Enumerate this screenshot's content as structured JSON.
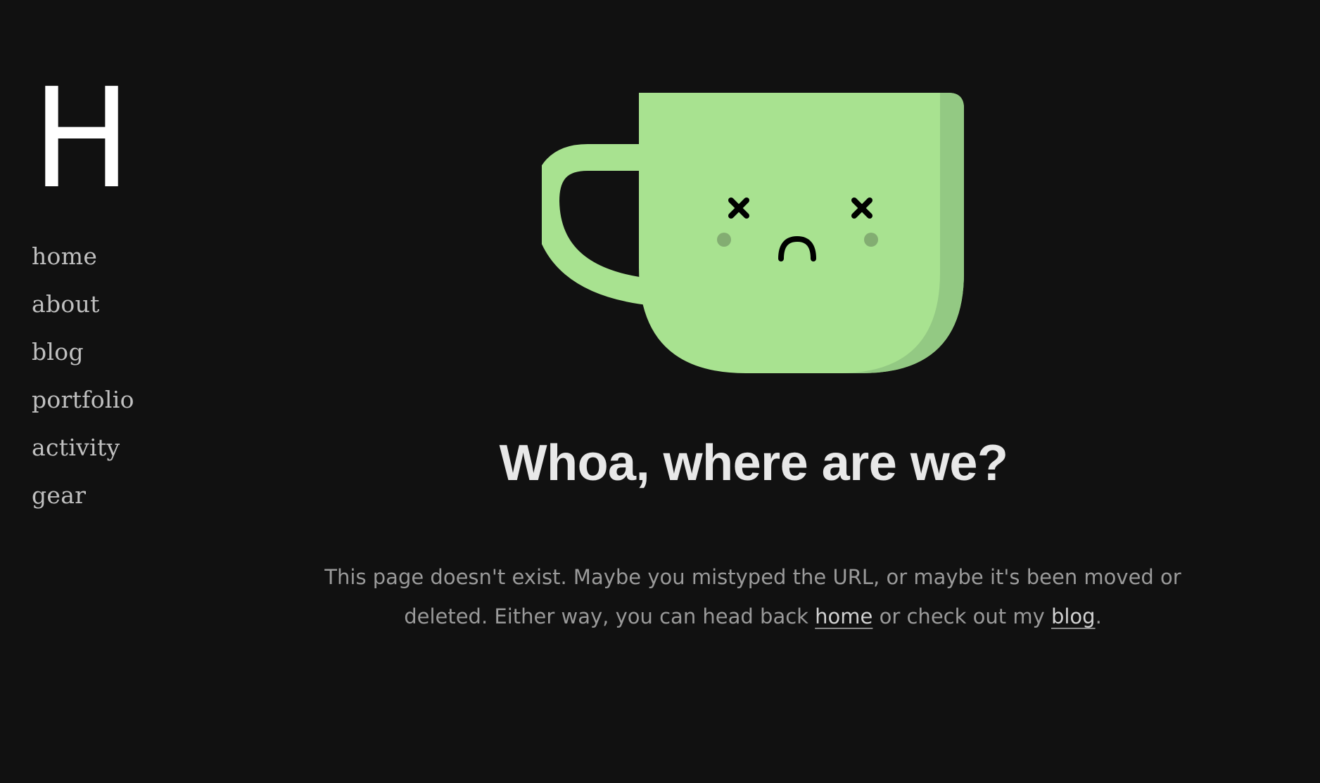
{
  "logo": {
    "text": "H"
  },
  "nav": {
    "items": [
      {
        "label": "home"
      },
      {
        "label": "about"
      },
      {
        "label": "blog"
      },
      {
        "label": "portfolio"
      },
      {
        "label": "activity"
      },
      {
        "label": "gear"
      }
    ]
  },
  "illustration": {
    "icon": "sad-mug-icon",
    "colors": {
      "mug": "#a8e290",
      "mug_shade": "#93c983",
      "face": "#000000",
      "cheek": "#83ad72"
    }
  },
  "main": {
    "headline": "Whoa, where are we?",
    "message": {
      "line1": "This page doesn't exist. Maybe you mistyped the URL, or maybe it's been moved or deleted. Either way, you can head back ",
      "home_link": "home",
      "middle": " or check out my ",
      "blog_link": "blog",
      "end": "."
    }
  },
  "colors": {
    "background": "#111111",
    "logo": "#ffffff",
    "nav_text": "#c0c0c0",
    "headline": "#e8e8e8",
    "body_text": "#9a9a9a"
  }
}
